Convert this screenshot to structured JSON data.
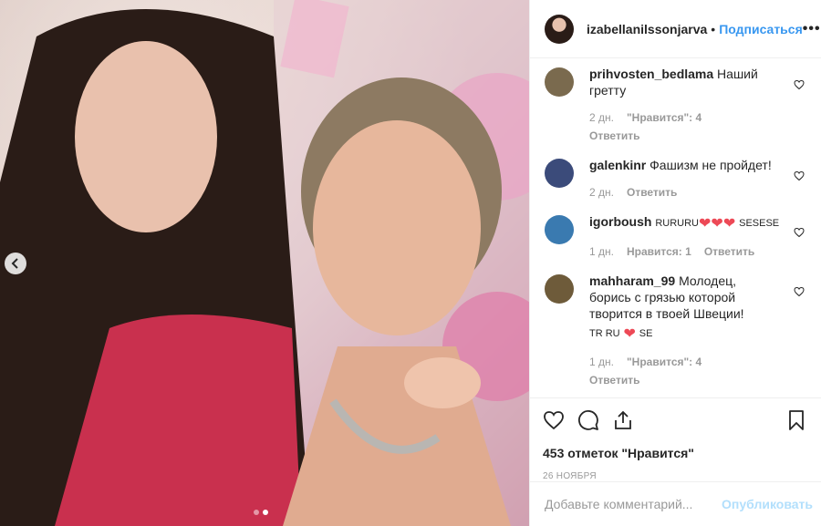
{
  "post": {
    "username": "izabellanilssonjarva",
    "separator": "•",
    "follow_label": "Подписаться",
    "more_label": "•••",
    "carousel_dots": 2,
    "carousel_active": 2
  },
  "comments": [
    {
      "username": "prihvosten_bedlama",
      "text": "Наший гретту",
      "time": "2 дн.",
      "likes": "\"Нравится\": 4",
      "reply": "Ответить",
      "avatar_color": "#7a6a4e"
    },
    {
      "username": "galenkinr",
      "text": "Фашизм не пройдет!",
      "time": "2 дн.",
      "reply": "Ответить",
      "avatar_color": "#3b4b7a"
    },
    {
      "username": "igorboush",
      "text_prefix": "RURURU",
      "text_suffix": "SESESE",
      "time": "1 дн.",
      "likes": "Нравится: 1",
      "reply": "Ответить",
      "avatar_color": "#3a7ab0"
    },
    {
      "username": "mahharam_99",
      "text": "Молодец, борись с грязью которой творится в твоей Швеции!",
      "line2_prefix": "TR RU",
      "line2_suffix": "SE",
      "time": "1 дн.",
      "likes": "\"Нравится\": 4",
      "reply": "Ответить",
      "avatar_color": "#6e5b3a"
    }
  ],
  "likes_count_label": "453 отметок \"Нравится\"",
  "date_label": "26 НОЯБРЯ",
  "add_comment": {
    "placeholder": "Добавьте комментарий...",
    "publish_label": "Опубликовать"
  },
  "icons": {
    "like": "heart-outline-icon",
    "comment": "comment-bubble-icon",
    "share": "share-upload-icon",
    "save": "bookmark-icon",
    "prev": "chevron-left-icon"
  },
  "colors": {
    "accent": "#3897f0",
    "publish_disabled": "#b2dffc",
    "meta_gray": "#999999",
    "heart_red": "#ed4956"
  }
}
